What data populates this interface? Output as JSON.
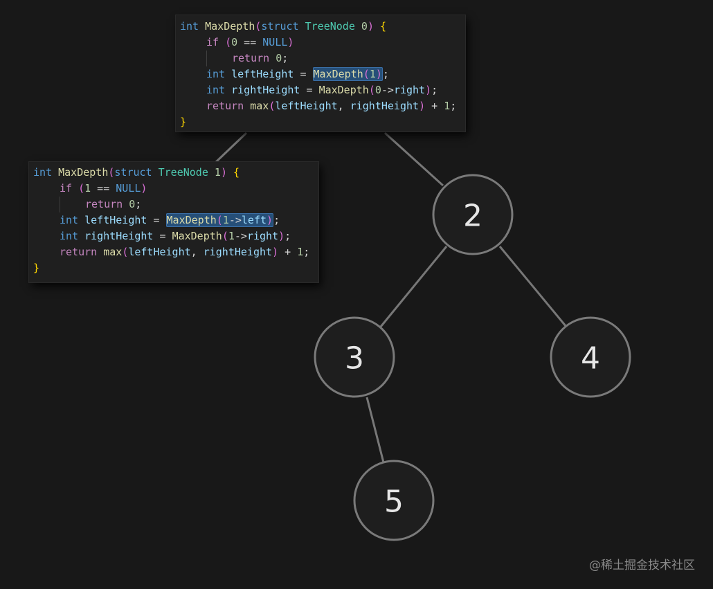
{
  "tree": {
    "nodes": [
      {
        "id": "n2",
        "label": "2"
      },
      {
        "id": "n3",
        "label": "3"
      },
      {
        "id": "n4",
        "label": "4"
      },
      {
        "id": "n5",
        "label": "5"
      }
    ]
  },
  "code_outer": {
    "lines": [
      {
        "indent": 0,
        "tokens": [
          {
            "t": "int",
            "c": "kw"
          },
          {
            "t": " "
          },
          {
            "t": "MaxDepth",
            "c": "fn"
          },
          {
            "t": "(",
            "c": "paren"
          },
          {
            "t": "struct",
            "c": "kw"
          },
          {
            "t": " "
          },
          {
            "t": "TreeNode",
            "c": "type"
          },
          {
            "t": " "
          },
          {
            "t": "0",
            "c": "num"
          },
          {
            "t": ")",
            "c": "paren"
          },
          {
            "t": " "
          },
          {
            "t": "{",
            "c": "brace"
          }
        ]
      },
      {
        "indent": 1,
        "tokens": [
          {
            "t": "if",
            "c": "ctrl"
          },
          {
            "t": " "
          },
          {
            "t": "(",
            "c": "paren"
          },
          {
            "t": "0",
            "c": "num"
          },
          {
            "t": " == "
          },
          {
            "t": "NULL",
            "c": "kw"
          },
          {
            "t": ")",
            "c": "paren"
          }
        ]
      },
      {
        "indent": 2,
        "guide": true,
        "tokens": [
          {
            "t": "return",
            "c": "ctrl"
          },
          {
            "t": " "
          },
          {
            "t": "0",
            "c": "num"
          },
          {
            "t": ";"
          }
        ]
      },
      {
        "indent": 1,
        "tokens": [
          {
            "t": "int",
            "c": "kw"
          },
          {
            "t": " "
          },
          {
            "t": "leftHeight",
            "c": "var"
          },
          {
            "t": " = "
          },
          {
            "t": "MaxDepth",
            "c": "fn",
            "hl": "start"
          },
          {
            "t": "(",
            "c": "paren",
            "hl": "mid"
          },
          {
            "t": "1",
            "c": "num",
            "hl": "mid"
          },
          {
            "t": ")",
            "c": "paren",
            "hl": "end"
          },
          {
            "t": ";"
          }
        ]
      },
      {
        "indent": 1,
        "tokens": [
          {
            "t": "int",
            "c": "kw"
          },
          {
            "t": " "
          },
          {
            "t": "rightHeight",
            "c": "var"
          },
          {
            "t": " = "
          },
          {
            "t": "MaxDepth",
            "c": "fn"
          },
          {
            "t": "(",
            "c": "paren"
          },
          {
            "t": "0",
            "c": "num"
          },
          {
            "t": "->"
          },
          {
            "t": "right",
            "c": "var"
          },
          {
            "t": ")",
            "c": "paren"
          },
          {
            "t": ";"
          }
        ]
      },
      {
        "indent": 1,
        "tokens": [
          {
            "t": "return",
            "c": "ctrl"
          },
          {
            "t": " "
          },
          {
            "t": "max",
            "c": "fn"
          },
          {
            "t": "(",
            "c": "paren"
          },
          {
            "t": "leftHeight",
            "c": "var"
          },
          {
            "t": ", "
          },
          {
            "t": "rightHeight",
            "c": "var"
          },
          {
            "t": ")",
            "c": "paren"
          },
          {
            "t": " + "
          },
          {
            "t": "1",
            "c": "num"
          },
          {
            "t": ";"
          }
        ]
      },
      {
        "indent": 0,
        "tokens": [
          {
            "t": "}",
            "c": "brace"
          }
        ]
      }
    ]
  },
  "code_inner": {
    "lines": [
      {
        "indent": 0,
        "tokens": [
          {
            "t": "int",
            "c": "kw"
          },
          {
            "t": " "
          },
          {
            "t": "MaxDepth",
            "c": "fn"
          },
          {
            "t": "(",
            "c": "paren"
          },
          {
            "t": "struct",
            "c": "kw"
          },
          {
            "t": " "
          },
          {
            "t": "TreeNode",
            "c": "type"
          },
          {
            "t": " "
          },
          {
            "t": "1",
            "c": "num"
          },
          {
            "t": ")",
            "c": "paren"
          },
          {
            "t": " "
          },
          {
            "t": "{",
            "c": "brace"
          }
        ]
      },
      {
        "indent": 1,
        "tokens": [
          {
            "t": "if",
            "c": "ctrl"
          },
          {
            "t": " "
          },
          {
            "t": "(",
            "c": "paren"
          },
          {
            "t": "1",
            "c": "num"
          },
          {
            "t": " == "
          },
          {
            "t": "NULL",
            "c": "kw"
          },
          {
            "t": ")",
            "c": "paren"
          }
        ]
      },
      {
        "indent": 2,
        "guide": true,
        "tokens": [
          {
            "t": "return",
            "c": "ctrl"
          },
          {
            "t": " "
          },
          {
            "t": "0",
            "c": "num"
          },
          {
            "t": ";"
          }
        ]
      },
      {
        "indent": 1,
        "tokens": [
          {
            "t": "int",
            "c": "kw"
          },
          {
            "t": " "
          },
          {
            "t": "leftHeight",
            "c": "var"
          },
          {
            "t": " = "
          },
          {
            "t": "MaxDepth",
            "c": "fn",
            "hl": "start"
          },
          {
            "t": "(",
            "c": "paren",
            "hl": "mid"
          },
          {
            "t": "1",
            "c": "num",
            "hl": "mid"
          },
          {
            "t": "->",
            "hl": "mid"
          },
          {
            "t": "left",
            "c": "var",
            "hl": "mid"
          },
          {
            "t": ")",
            "c": "paren",
            "hl": "end"
          },
          {
            "t": ";"
          }
        ]
      },
      {
        "indent": 1,
        "tokens": [
          {
            "t": "int",
            "c": "kw"
          },
          {
            "t": " "
          },
          {
            "t": "rightHeight",
            "c": "var"
          },
          {
            "t": " = "
          },
          {
            "t": "MaxDepth",
            "c": "fn"
          },
          {
            "t": "(",
            "c": "paren"
          },
          {
            "t": "1",
            "c": "num"
          },
          {
            "t": "->"
          },
          {
            "t": "right",
            "c": "var"
          },
          {
            "t": ")",
            "c": "paren"
          },
          {
            "t": ";"
          }
        ]
      },
      {
        "indent": 1,
        "tokens": [
          {
            "t": "return",
            "c": "ctrl"
          },
          {
            "t": " "
          },
          {
            "t": "max",
            "c": "fn"
          },
          {
            "t": "(",
            "c": "paren"
          },
          {
            "t": "leftHeight",
            "c": "var"
          },
          {
            "t": ", "
          },
          {
            "t": "rightHeight",
            "c": "var"
          },
          {
            "t": ")",
            "c": "paren"
          },
          {
            "t": " + "
          },
          {
            "t": "1",
            "c": "num"
          },
          {
            "t": ";"
          }
        ]
      },
      {
        "indent": 0,
        "tokens": [
          {
            "t": "}",
            "c": "brace"
          }
        ]
      }
    ]
  },
  "watermark": "@稀土掘金技术社区"
}
